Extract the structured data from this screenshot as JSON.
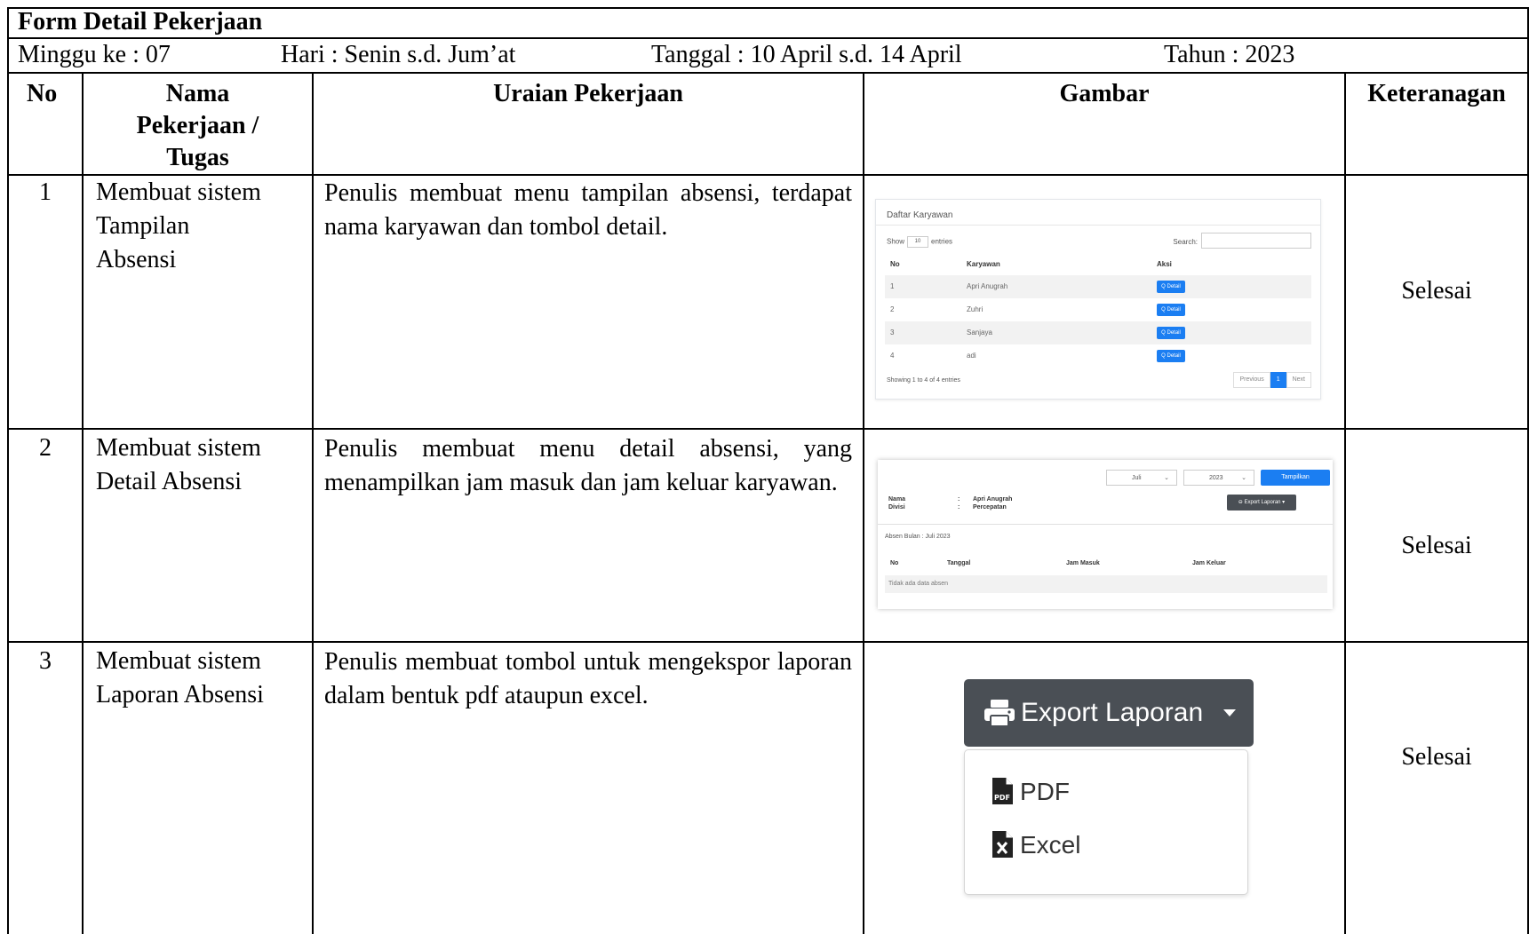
{
  "form_title": "Form Detail Pekerjaan",
  "meta": {
    "minggu": "Minggu ke : 07",
    "hari": "Hari : Senin  s.d. Jum’at",
    "tanggal": "Tanggal :  10 April s.d. 14 April",
    "tahun": "Tahun : 2023"
  },
  "headers": {
    "no": "No",
    "nama_line1": "Nama",
    "nama_line2": "Pekerjaan /",
    "nama_line3": "Tugas",
    "uraian": "Uraian Pekerjaan",
    "gambar": "Gambar",
    "keterangan": "Keteranagan"
  },
  "rows": [
    {
      "no": "1",
      "nama_line1": "Membuat  sistem",
      "nama_line2": "Tampilan",
      "nama_line3": "Absensi",
      "uraian": "Penulis membuat menu tampilan absensi, terdapat nama karyawan dan tombol detail.",
      "keterangan": "Selesai"
    },
    {
      "no": "2",
      "nama_line1": "Membuat  sistem",
      "nama_line2": "Detail Absensi",
      "uraian": "Penulis membuat menu detail absensi, yang menampilkan jam masuk dan jam keluar karyawan.",
      "keterangan": "Selesai"
    },
    {
      "no": "3",
      "nama_line1": "Membuat  sistem",
      "nama_line2": "Laporan Absensi",
      "uraian": "Penulis membuat tombol untuk mengekspor laporan dalam bentuk pdf ataupun excel.",
      "keterangan": "Selesai"
    }
  ],
  "shot1": {
    "title": "Daftar Karyawan",
    "show": "Show",
    "show_value": "10",
    "entries": "entries",
    "search": "Search:",
    "col_no": "No",
    "col_karyawan": "Karyawan",
    "col_aksi": "Aksi",
    "btn_detail": "Q Detail",
    "list": [
      {
        "no": "1",
        "name": "Apri Anugrah"
      },
      {
        "no": "2",
        "name": "Zuhri"
      },
      {
        "no": "3",
        "name": "Sanjaya"
      },
      {
        "no": "4",
        "name": "adi"
      }
    ],
    "footer": "Showing 1 to 4 of 4 entries",
    "prev": "Previous",
    "page": "1",
    "next": "Next"
  },
  "shot2": {
    "month": "Juli",
    "year": "2023",
    "tampilkan": "Tampilkan",
    "nama_lbl": "Nama",
    "divisi_lbl": "Divisi",
    "colon": ":",
    "nama_val": "Apri Anugrah",
    "divisi_val": "Percepatan",
    "export": "⊖ Export Laporan ▾",
    "absen_bulan": "Absen Bulan : Juli 2023",
    "col_no": "No",
    "col_tanggal": "Tanggal",
    "col_masuk": "Jam Masuk",
    "col_keluar": "Jam Keluar",
    "empty": "Tidak ada data absen"
  },
  "shot3": {
    "export": "Export Laporan",
    "pdf": "PDF",
    "excel": "Excel"
  }
}
